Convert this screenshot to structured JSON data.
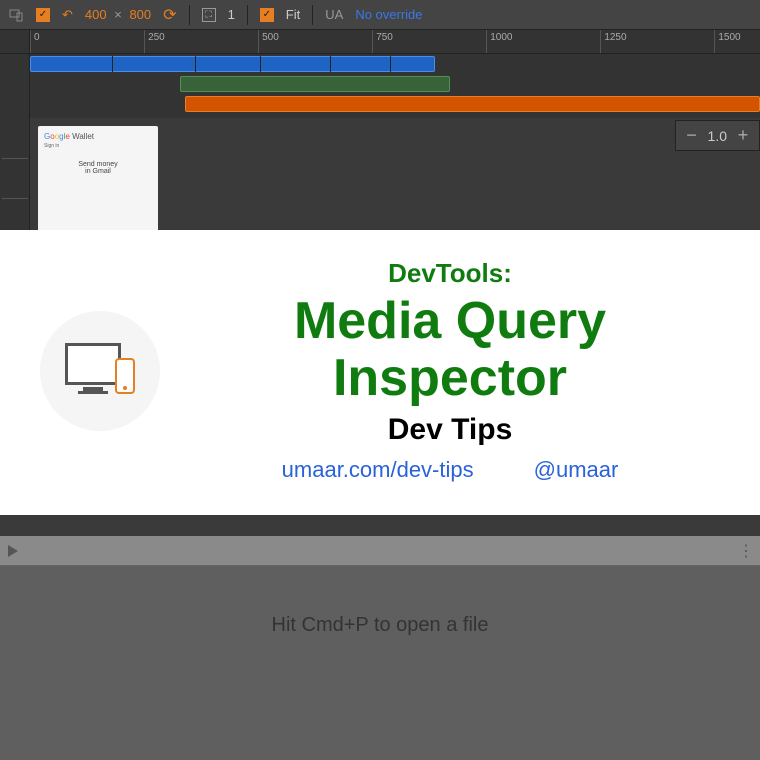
{
  "toolbar": {
    "width": "400",
    "height": "800",
    "scale": "1",
    "fit_label": "Fit",
    "ua_label": "UA",
    "ua_value": "No override"
  },
  "ruler_ticks": [
    "0",
    "250",
    "500",
    "750",
    "1000",
    "1250",
    "1500"
  ],
  "preview": {
    "logo_text": "Google Wallet",
    "signin": "Sign in",
    "hero_line1": "Send money",
    "hero_line2": "in Gmail"
  },
  "zoom": {
    "value": "1.0"
  },
  "panel": {
    "pre": "DevTools:",
    "main": "Media Query Inspector",
    "sub": "Dev Tips",
    "link1": "umaar.com/dev-tips",
    "link2": "@umaar"
  },
  "bottom": {
    "hint": "Hit Cmd+P to open a file"
  }
}
